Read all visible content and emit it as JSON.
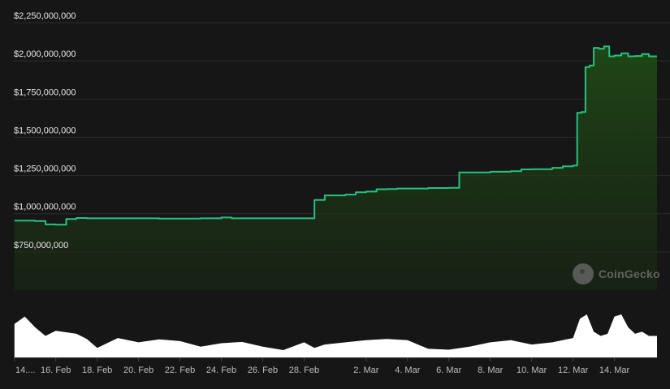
{
  "chart_data": {
    "type": "area",
    "title": "",
    "xlabel": "",
    "ylabel": "",
    "ylim": [
      500000000,
      2250000000
    ],
    "y_ticks": [
      750000000,
      1000000000,
      1250000000,
      1500000000,
      1750000000,
      2000000000,
      2250000000
    ],
    "y_tick_labels": [
      "$750,000,000",
      "$1,000,000,000",
      "$1,250,000,000",
      "$1,500,000,000",
      "$1,750,000,000",
      "$2,000,000,000",
      "$2,250,000,000"
    ],
    "x_tick_labels": [
      "14....",
      "16. Feb",
      "18. Feb",
      "20. Feb",
      "22. Feb",
      "24. Feb",
      "26. Feb",
      "28. Feb",
      "2. Mar",
      "4. Mar",
      "6. Mar",
      "8. Mar",
      "10. Mar",
      "12. Mar",
      "14. Mar"
    ],
    "grid": true,
    "series": [
      {
        "color": "#26c281",
        "x": [
          "2024-02-14",
          "2024-02-15",
          "2024-02-15",
          "2024-02-16",
          "2024-02-16",
          "2024-02-17",
          "2024-02-17",
          "2024-02-19",
          "2024-02-21",
          "2024-02-23",
          "2024-02-24",
          "2024-02-24",
          "2024-02-26",
          "2024-02-27",
          "2024-02-27",
          "2024-02-28",
          "2024-02-28",
          "2024-02-29",
          "2024-03-01",
          "2024-03-01",
          "2024-03-02",
          "2024-03-02",
          "2024-03-03",
          "2024-03-03",
          "2024-03-05",
          "2024-03-06",
          "2024-03-06",
          "2024-03-08",
          "2024-03-09",
          "2024-03-09",
          "2024-03-10",
          "2024-03-11",
          "2024-03-11",
          "2024-03-12",
          "2024-03-12",
          "2024-03-12",
          "2024-03-12",
          "2024-03-12",
          "2024-03-13",
          "2024-03-13",
          "2024-03-13",
          "2024-03-13",
          "2024-03-14",
          "2024-03-14",
          "2024-03-14",
          "2024-03-15",
          "2024-03-15",
          "2024-03-15"
        ],
        "y": [
          955000000,
          952000000,
          930000000,
          928000000,
          965000000,
          972000000,
          970000000,
          970000000,
          968000000,
          970000000,
          975000000,
          970000000,
          970000000,
          970000000,
          970000000,
          970000000,
          1090000000,
          1120000000,
          1125000000,
          1140000000,
          1145000000,
          1160000000,
          1162000000,
          1165000000,
          1168000000,
          1170000000,
          1270000000,
          1275000000,
          1278000000,
          1290000000,
          1292000000,
          1300000000,
          1310000000,
          1315000000,
          1660000000,
          1665000000,
          1960000000,
          1970000000,
          2085000000,
          2080000000,
          2095000000,
          2030000000,
          2035000000,
          2050000000,
          2030000000,
          2032000000,
          2045000000,
          2030000000
        ]
      }
    ],
    "volume": {
      "color": "#ffffff",
      "x": [
        "2024-02-14",
        "2024-02-14",
        "2024-02-15",
        "2024-02-15",
        "2024-02-16",
        "2024-02-17",
        "2024-02-17",
        "2024-02-18",
        "2024-02-19",
        "2024-02-20",
        "2024-02-21",
        "2024-02-22",
        "2024-02-23",
        "2024-02-24",
        "2024-02-25",
        "2024-02-26",
        "2024-02-27",
        "2024-02-28",
        "2024-02-28",
        "2024-02-29",
        "2024-03-01",
        "2024-03-02",
        "2024-03-03",
        "2024-03-04",
        "2024-03-05",
        "2024-03-06",
        "2024-03-07",
        "2024-03-08",
        "2024-03-09",
        "2024-03-10",
        "2024-03-11",
        "2024-03-12",
        "2024-03-12",
        "2024-03-12",
        "2024-03-13",
        "2024-03-13",
        "2024-03-13",
        "2024-03-14",
        "2024-03-14",
        "2024-03-14",
        "2024-03-15",
        "2024-03-15",
        "2024-03-15"
      ],
      "values": [
        0.78,
        0.95,
        0.7,
        0.5,
        0.62,
        0.55,
        0.43,
        0.22,
        0.45,
        0.35,
        0.42,
        0.38,
        0.25,
        0.33,
        0.36,
        0.25,
        0.17,
        0.35,
        0.22,
        0.3,
        0.35,
        0.4,
        0.43,
        0.4,
        0.2,
        0.18,
        0.25,
        0.35,
        0.4,
        0.3,
        0.35,
        0.45,
        0.9,
        1.0,
        0.6,
        0.5,
        0.55,
        0.95,
        1.0,
        0.7,
        0.55,
        0.6,
        0.5
      ]
    }
  },
  "watermark": {
    "text": "CoinGecko",
    "icon": "coingecko-logo-icon"
  }
}
